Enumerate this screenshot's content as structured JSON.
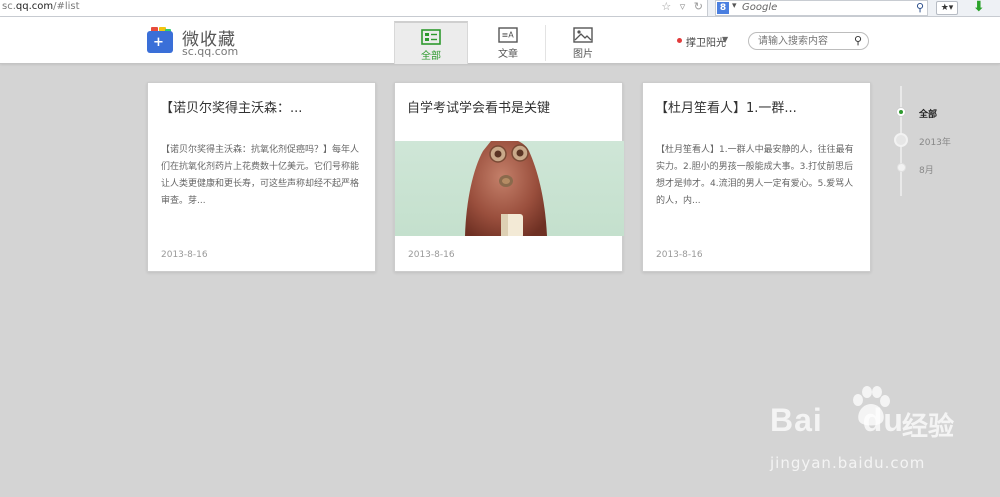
{
  "browser": {
    "url_prefix": "sc.",
    "url_domain": "qq.com",
    "url_suffix": "/#list",
    "search_engine_letter": "8",
    "search_placeholder": "Google"
  },
  "header": {
    "logo_title": "微收藏",
    "logo_sub": "sc.qq.com",
    "tabs": [
      {
        "label": "全部",
        "icon": "list-icon",
        "active": true
      },
      {
        "label": "文章",
        "icon": "article-icon",
        "active": false
      },
      {
        "label": "图片",
        "icon": "image-icon",
        "active": false
      }
    ],
    "user_name": "撑卫阳光",
    "search_placeholder": "请输入搜索内容"
  },
  "cards": [
    {
      "title": "【诺贝尔奖得主沃森：...",
      "excerpt": "【诺贝尔奖得主沃森：抗氧化剂促癌吗？】每年人们在抗氧化剂药片上花费数十亿美元。它们号称能让人类更健康和更长寿，可这些声称却经不起严格审查。芽...",
      "date": "2013-8-16",
      "has_image": false
    },
    {
      "title": "自学考试学会看书是关键",
      "excerpt": "",
      "date": "2013-8-16",
      "has_image": true
    },
    {
      "title": "【杜月笙看人】1.一群...",
      "excerpt": "【杜月笙看人】1.一群人中最安静的人，往往最有实力。2.胆小的男孩一般能成大事。3.打仗前思后想才是帅才。4.流泪的男人一定有爱心。5.爱骂人的人，内...",
      "date": "2013-8-16",
      "has_image": false
    }
  ],
  "timeline": {
    "items": [
      "全部",
      "2013年",
      "8月"
    ]
  },
  "watermark": {
    "brand": "Bai",
    "brand2": "du",
    "cn": "经验",
    "url": "jingyan.baidu.com"
  },
  "colors": {
    "accent": "#2e9a2e",
    "background": "#d4d4d4",
    "user_dot": "#e23b3b"
  }
}
